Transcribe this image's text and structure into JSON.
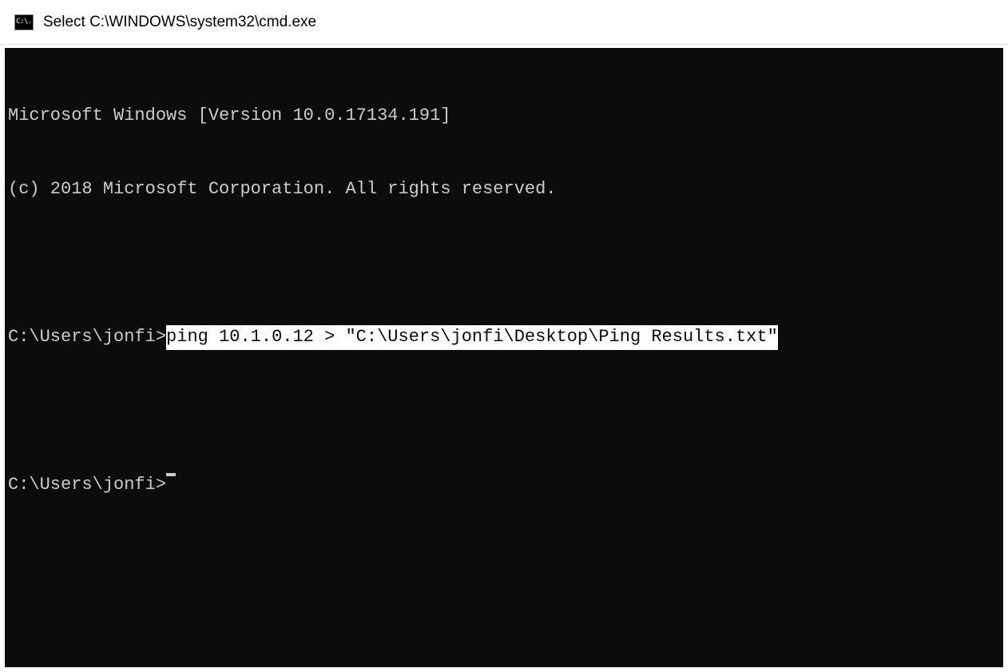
{
  "titlebar": {
    "icon_text": "C:\\.",
    "title": "Select C:\\WINDOWS\\system32\\cmd.exe"
  },
  "terminal": {
    "banner_line1": "Microsoft Windows [Version 10.0.17134.191]",
    "banner_line2": "(c) 2018 Microsoft Corporation. All rights reserved.",
    "prompt1_path": "C:\\Users\\jonfi>",
    "prompt1_command": "ping 10.1.0.12 > \"C:\\Users\\jonfi\\Desktop\\Ping Results.txt\"",
    "prompt2_path": "C:\\Users\\jonfi>"
  }
}
